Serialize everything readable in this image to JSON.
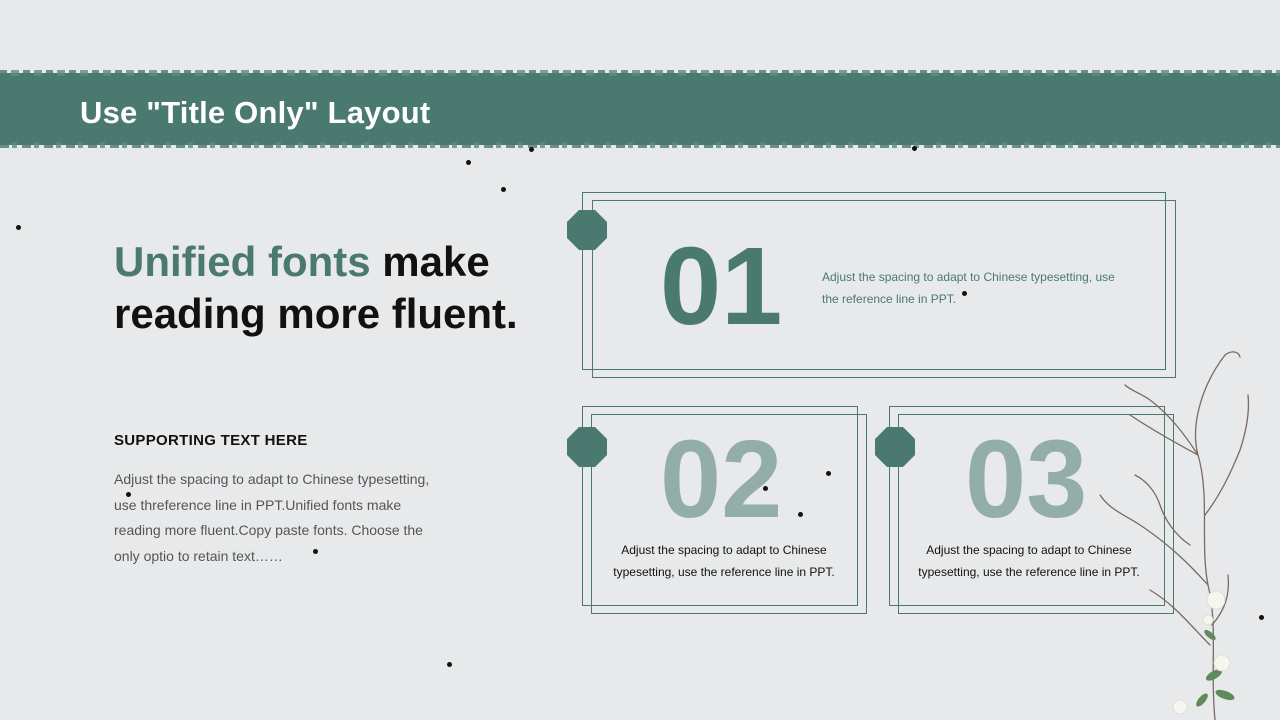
{
  "slide": {
    "title": "Use \"Title Only\" Layout",
    "headline": {
      "accent": "Unified fonts",
      "rest_line1": " make",
      "line2": "reading more fluent."
    },
    "supporting": {
      "title": "SUPPORTING  TEXT HERE",
      "body": "Adjust the spacing to adapt to Chinese typesetting, use threference line in PPT.Unified fonts make reading more fluent.Copy paste fonts. Choose the only optio to retain text……"
    },
    "cards": [
      {
        "number": "01",
        "text": "Adjust the spacing to adapt to Chinese typesetting, use the reference line in PPT."
      },
      {
        "number": "02",
        "text": "Adjust the spacing to adapt to Chinese typesetting, use the reference line in PPT."
      },
      {
        "number": "03",
        "text": "Adjust the spacing to adapt to Chinese typesetting, use the reference line in PPT."
      }
    ]
  },
  "colors": {
    "accent": "#4a7a6f",
    "faded_number": "#93aea8",
    "background": "#e8e9ea"
  },
  "decorations": [
    "scattered-dots",
    "branch-with-white-flowers"
  ]
}
